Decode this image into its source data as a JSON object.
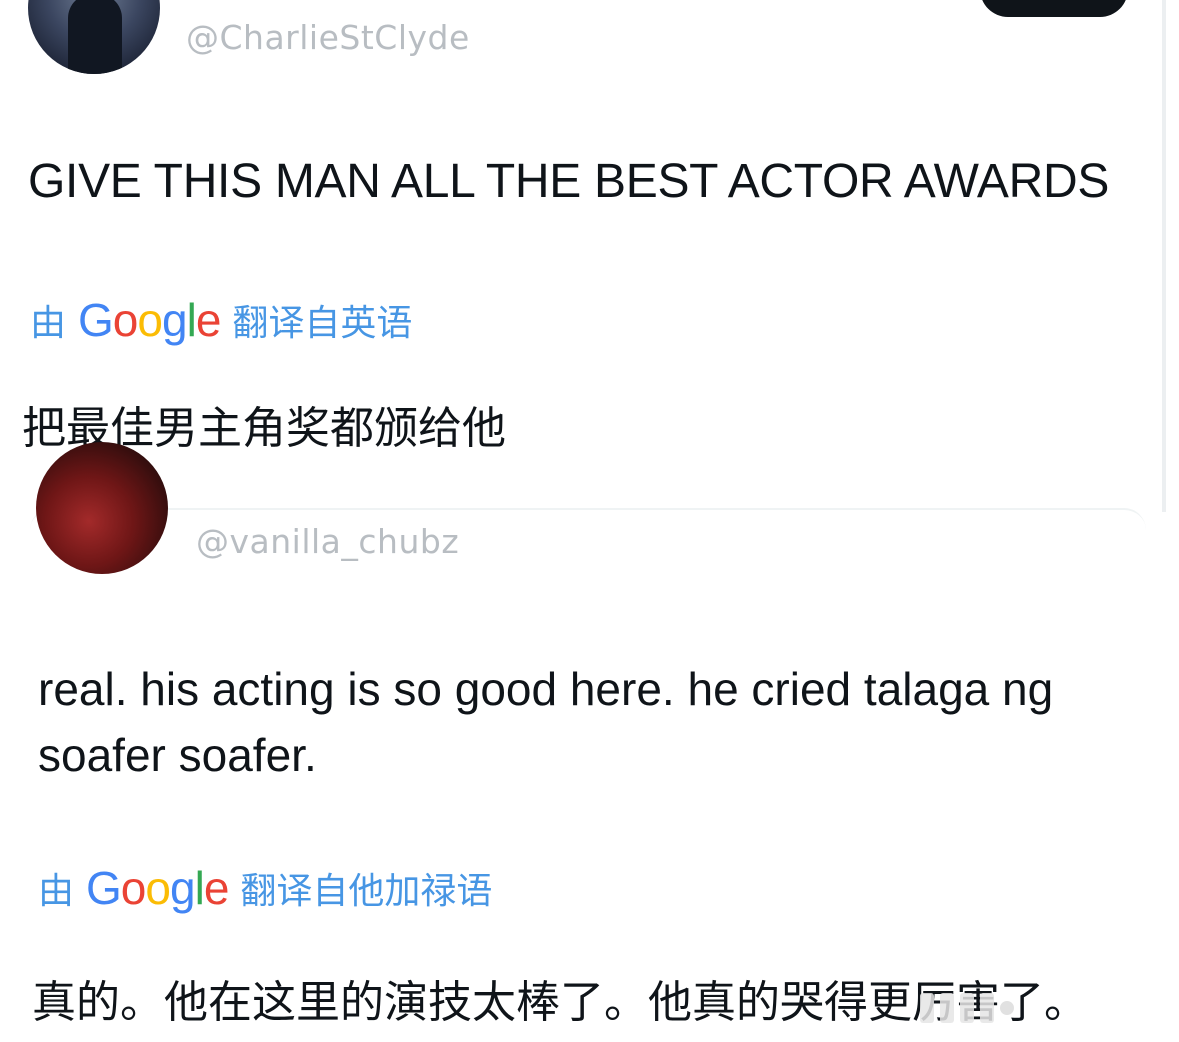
{
  "tweet1": {
    "handle": "@CharlieStClyde",
    "text": "GIVE THIS MAN ALL THE BEST ACTOR AWARDS",
    "translation": {
      "by_label": "由",
      "google_letters": [
        "G",
        "o",
        "o",
        "g",
        "l",
        "e"
      ],
      "from_label": "翻译自英语",
      "translated_text": "把最佳男主角奖都颁给他"
    }
  },
  "tweet2": {
    "handle": "@vanilla_chubz",
    "text": "real. his acting is so good here. he cried talaga ng soafer soafer.",
    "translation": {
      "by_label": "由",
      "google_letters": [
        "G",
        "o",
        "o",
        "g",
        "l",
        "e"
      ],
      "from_label": "翻译自他加禄语",
      "translated_text": "真的。他在这里的演技太棒了。他真的哭得更厉害了。"
    }
  },
  "colors": {
    "translate_blue": "#4796e4",
    "handle_gray": "#b8bdc2",
    "text_black": "#0f1419",
    "google_blue": "#4285f4",
    "google_red": "#ea4335",
    "google_yellow": "#fbbc05",
    "google_green": "#34a853"
  },
  "icons": {
    "avatar1": "profile-avatar",
    "avatar2": "profile-avatar",
    "follow": "follow-button"
  }
}
